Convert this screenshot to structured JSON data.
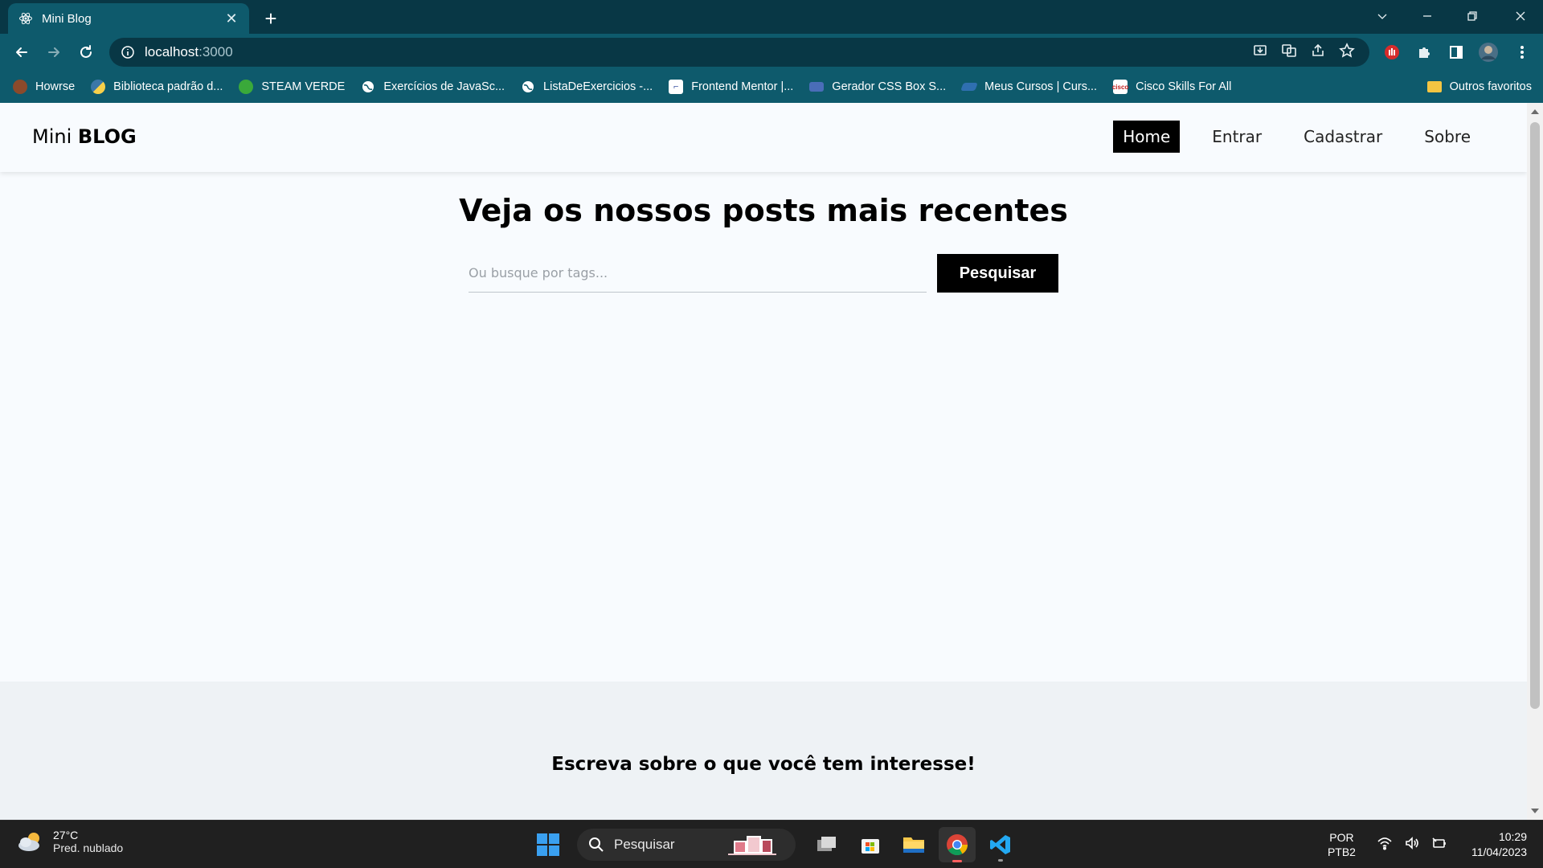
{
  "browser": {
    "tab": {
      "title": "Mini Blog"
    },
    "omnibox": {
      "host": "localhost",
      "port": ":3000"
    },
    "bookmarks": [
      {
        "label": "Howrse",
        "color": "#8b4a2b"
      },
      {
        "label": "Biblioteca padrão d...",
        "color": "#3b77a8"
      },
      {
        "label": "STEAM VERDE",
        "color": "#3aa93a"
      },
      {
        "label": "Exercícios de JavaSc...",
        "color": "#ffffff"
      },
      {
        "label": "ListaDeExercicios -...",
        "color": "#ffffff"
      },
      {
        "label": "Frontend Mentor |...",
        "color": "#ffffff"
      },
      {
        "label": "Gerador CSS Box S...",
        "color": "#4a6db8"
      },
      {
        "label": "Meus Cursos | Curs...",
        "color": "#2f6fb0"
      },
      {
        "label": "Cisco Skills For All",
        "color": "#d0d0d0"
      }
    ],
    "bookmarks_folder": "Outros favoritos"
  },
  "site": {
    "brand_light": "Mini ",
    "brand_bold": "BLOG",
    "nav": [
      {
        "label": "Home",
        "active": true
      },
      {
        "label": "Entrar",
        "active": false
      },
      {
        "label": "Cadastrar",
        "active": false
      },
      {
        "label": "Sobre",
        "active": false
      }
    ],
    "hero_title": "Veja os nossos posts mais recentes",
    "search": {
      "placeholder": "Ou busque por tags...",
      "button": "Pesquisar"
    },
    "footer_text": "Escreva sobre o que você tem interesse!"
  },
  "taskbar": {
    "weather": {
      "temp": "27°C",
      "condition": "Pred. nublado"
    },
    "search_label": "Pesquisar",
    "lang_top": "POR",
    "lang_bottom": "PTB2",
    "time": "10:29",
    "date": "11/04/2023"
  },
  "colors": {
    "chrome_frame": "#083745",
    "chrome_toolbar": "#0e5a6c",
    "page_bg": "#f8fbfe",
    "accent": "#000000"
  }
}
